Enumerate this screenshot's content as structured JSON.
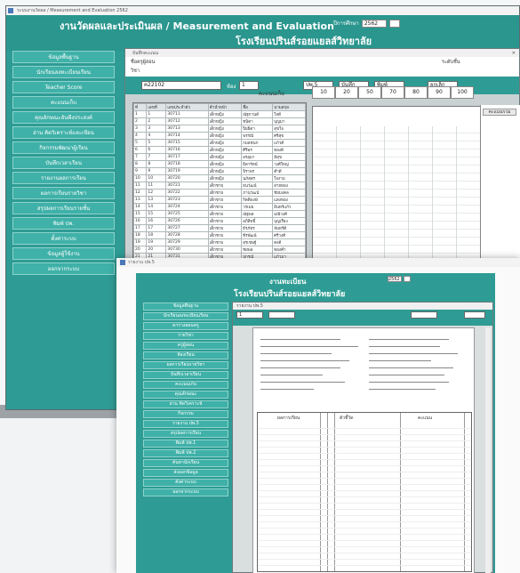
{
  "app": {
    "window_title": "ระบบงานวัดผล / Measurement and Evaluation 2562",
    "header_title": "งานวัดผลและประเมินผล / Measurement and Evaluation",
    "school_name": "โรงเรียนปรินส์รอยแยลส์วิทยาลัย",
    "year_label": "ปีการศึกษา",
    "year_value": "2562"
  },
  "side_menu": [
    "ข้อมูลพื้นฐาน",
    "นักเรียนลงทะเบียนเรียน",
    "Teacher Score",
    "คะแนนเก็บ",
    "คุณลักษณะอันพึงประสงค์",
    "อ่าน คิดวิเคราะห์และเขียน",
    "กิจกรรมพัฒนาผู้เรียน",
    "บันทึกเวลาเรียน",
    "รายงานผลการเรียน",
    "ผลการเรียนรายวิชา",
    "สรุปผลการเรียนรายชั้น",
    "พิมพ์ ปพ.",
    "ตั้งค่าระบบ",
    "ข้อมูลผู้ใช้งาน",
    "ออกจากระบบ"
  ],
  "grades_form": {
    "title": "บันทึกคะแนน",
    "teacher_label": "ชื่อครูผู้สอน",
    "subject_label": "วิชา",
    "class_label": "ระดับชั้น",
    "course_code": "ค22102",
    "room_label": "ห้อง",
    "room_value": "1",
    "buttons": [
      "ปพ.5",
      "บันทึก",
      "พิมพ์",
      "ยกเลิก"
    ],
    "section_label": "คะแนนเก็บ",
    "max_scores": [
      "10",
      "20",
      "50",
      "70",
      "80",
      "90",
      "100"
    ],
    "col_headers": [
      "ที่",
      "เลขที่",
      "เลขประจำตัว",
      "คำนำหน้า",
      "ชื่อ",
      "นามสกุล"
    ],
    "rows": [
      [
        "1",
        "1",
        "30711",
        "เด็กหญิง",
        "ณัฐกานต์",
        "ใจดี"
      ],
      [
        "2",
        "2",
        "30712",
        "เด็กหญิง",
        "ชนิดา",
        "บุญมา"
      ],
      [
        "3",
        "3",
        "30713",
        "เด็กหญิง",
        "ปิยธิดา",
        "สุขใจ"
      ],
      [
        "4",
        "4",
        "30714",
        "เด็กหญิง",
        "พรรณี",
        "ศรีสุข"
      ],
      [
        "5",
        "5",
        "30715",
        "เด็กหญิง",
        "กมลชนก",
        "แก้วดี"
      ],
      [
        "6",
        "6",
        "30716",
        "เด็กหญิง",
        "ศิริพร",
        "ทองดี"
      ],
      [
        "7",
        "7",
        "30717",
        "เด็กหญิง",
        "อรอุมา",
        "มีสุข"
      ],
      [
        "8",
        "8",
        "30718",
        "เด็กหญิง",
        "ธิดารัตน์",
        "วงศ์ใหญ่"
      ],
      [
        "9",
        "9",
        "30719",
        "เด็กหญิง",
        "จิราพร",
        "คำดี"
      ],
      [
        "10",
        "10",
        "30720",
        "เด็กหญิง",
        "นภัสสร",
        "ใจงาม"
      ],
      [
        "11",
        "11",
        "30721",
        "เด็กชาย",
        "ธนวัฒน์",
        "สายทอง"
      ],
      [
        "12",
        "12",
        "30722",
        "เด็กชาย",
        "ภานุวัฒน์",
        "ชัยมงคล"
      ],
      [
        "13",
        "13",
        "30723",
        "เด็กชาย",
        "กิตติพงษ์",
        "แสงทอง"
      ],
      [
        "14",
        "14",
        "30724",
        "เด็กชาย",
        "วรเมธ",
        "อินทร์แก้ว"
      ],
      [
        "15",
        "15",
        "30725",
        "เด็กชาย",
        "ณัฐพล",
        "มณีวงศ์"
      ],
      [
        "16",
        "16",
        "30726",
        "เด็กชาย",
        "อภิสิทธิ์",
        "บุญเรือง"
      ],
      [
        "17",
        "17",
        "30727",
        "เด็กชาย",
        "ธีรภัทร",
        "จันทร์ดี"
      ],
      [
        "18",
        "18",
        "30728",
        "เด็กชาย",
        "พีรพัฒน์",
        "ศรีวงศ์"
      ],
      [
        "19",
        "19",
        "30729",
        "เด็กชาย",
        "สุรเชษฐ์",
        "คงดี"
      ],
      [
        "20",
        "20",
        "30730",
        "เด็กชาย",
        "ชยพล",
        "ทองคำ"
      ],
      [
        "21",
        "21",
        "30731",
        "เด็กชาย",
        "ปกรณ์",
        "แก้วมา"
      ],
      [
        "22",
        "22",
        "30732",
        "เด็กชาย",
        "ศุภกร",
        "ดวงดี"
      ],
      [
        "23",
        "23",
        "30733",
        "เด็กชาย",
        "อนุชา",
        "มีชัย"
      ],
      [
        "24",
        "24",
        "30734",
        "เด็กชาย",
        "ภูมิพัฒน์",
        "ไชยา"
      ]
    ]
  },
  "right_strip": {
    "tag": "คะแนนรวม"
  },
  "report_window": {
    "title": "รายงาน ปพ.5",
    "header_t1": "งานทะเบียน",
    "school_name": "โรงเรียนปรินส์รอยแยลส์วิทยาลัย",
    "year_value": "2562",
    "filter_value": "1",
    "menu": [
      "ข้อมูลพื้นฐาน",
      "นักเรียนลงทะเบียนเรียน",
      "ตารางสอนครู",
      "รายวิชา",
      "ครูผู้สอน",
      "ห้องเรียน",
      "ผลการเรียนรายวิชา",
      "บันทึกเวลาเรียน",
      "คะแนนเก็บ",
      "คุณลักษณะ",
      "อ่าน คิดวิเคราะห์",
      "กิจกรรม",
      "รายงาน ปพ.5",
      "สรุปผลการเรียน",
      "พิมพ์ ปพ.1",
      "พิมพ์ ปพ.2",
      "ค้นหานักเรียน",
      "ส่งออกข้อมูล",
      "ตั้งค่าระบบ",
      "ออกจากระบบ"
    ],
    "table_headers": [
      "ผลการเรียน",
      "ตัวชี้วัด",
      "คะแนน"
    ]
  }
}
